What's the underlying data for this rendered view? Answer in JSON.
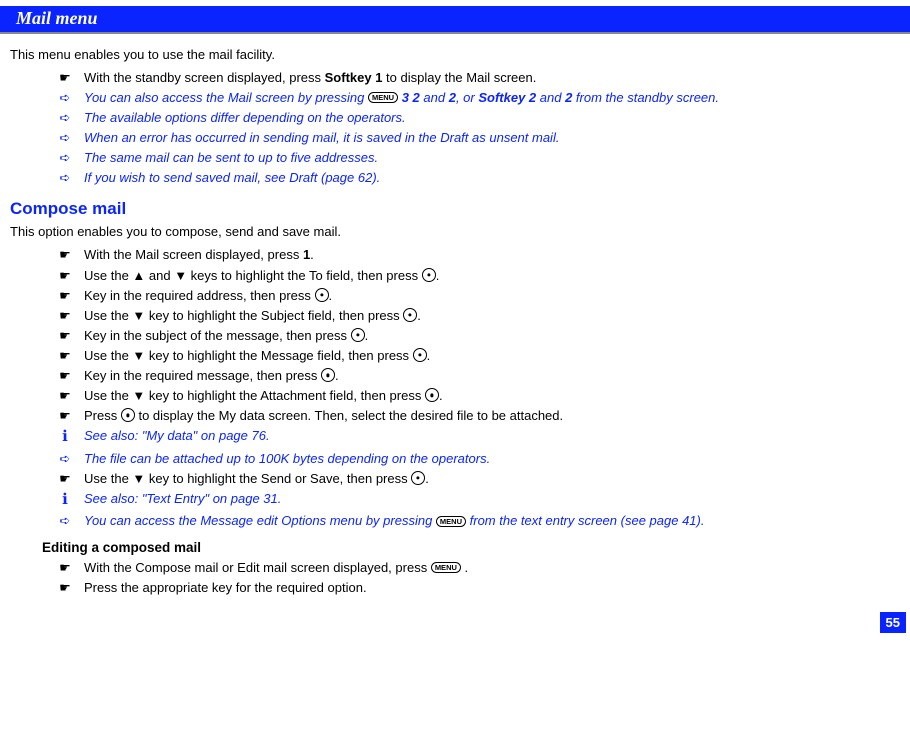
{
  "header": {
    "title": "Mail menu"
  },
  "intro": {
    "p1": "This menu enables you to use the mail facility.",
    "line1_pre": "With the standby screen displayed, press ",
    "line1_b": "Softkey 1",
    "line1_post": " to display the Mail screen.",
    "line2_pre": "You can also access the Mail screen by pressing ",
    "line2_mid1": " ",
    "line2_b1": "3 2",
    "line2_mid2": " and ",
    "line2_b2": "2",
    "line2_mid3": ", or ",
    "line2_b3": "Softkey 2",
    "line2_mid4": " and ",
    "line2_b4": "2",
    "line2_post": " from the standby screen.",
    "line3": "The available options differ depending on the operators.",
    "line4": "When an error has occurred in sending mail, it is saved in the Draft as unsent mail.",
    "line5": "The same mail can be sent to up to five addresses.",
    "line6": "If you wish to send saved mail, see Draft (page 62)."
  },
  "compose": {
    "title": "Compose mail",
    "p1": "This option enables you to compose, send and save mail.",
    "s1_pre": "With the Mail screen displayed, press ",
    "s1_b": "1",
    "s1_post": ".",
    "s2_pre": "Use the ▲ and ▼ keys to highlight the To field, then press ",
    "s2_post": ".",
    "s3_pre": "Key in the required address, then press ",
    "s3_post": ".",
    "s4_pre": "Use the ▼ key to highlight the Subject field, then press ",
    "s4_post": ".",
    "s5_pre": "Key in the subject of the message, then press ",
    "s5_post": ".",
    "s6_pre": "Use the ▼ key to highlight the Message field, then press ",
    "s6_post": ".",
    "s7_pre": "Key in the required message, then press ",
    "s7_post": ".",
    "s8_pre": "Use the ▼ key to highlight the Attachment field, then press ",
    "s8_post": ".",
    "s9_pre": "Press ",
    "s9_post": " to display the My data screen. Then, select the desired file to be attached.",
    "see1": "See also: \"My data\" on page 76.",
    "note1": "The file can be attached up to 100K bytes depending on the operators.",
    "s10_pre": "Use the ▼ key to highlight the Send or Save, then press ",
    "s10_post": ".",
    "see2": "See also: \"Text Entry\" on page 31.",
    "note2_pre": "You can access the Message edit Options menu by pressing ",
    "note2_post": " from the text entry screen (see page 41)."
  },
  "edit": {
    "heading": "Editing a composed mail",
    "s1_pre": "With the Compose mail or Edit mail screen displayed, press ",
    "s1_post": " .",
    "s2": "Press the appropriate key for the required option."
  },
  "icons": {
    "menu": "MENU"
  },
  "page": {
    "num": "55"
  }
}
